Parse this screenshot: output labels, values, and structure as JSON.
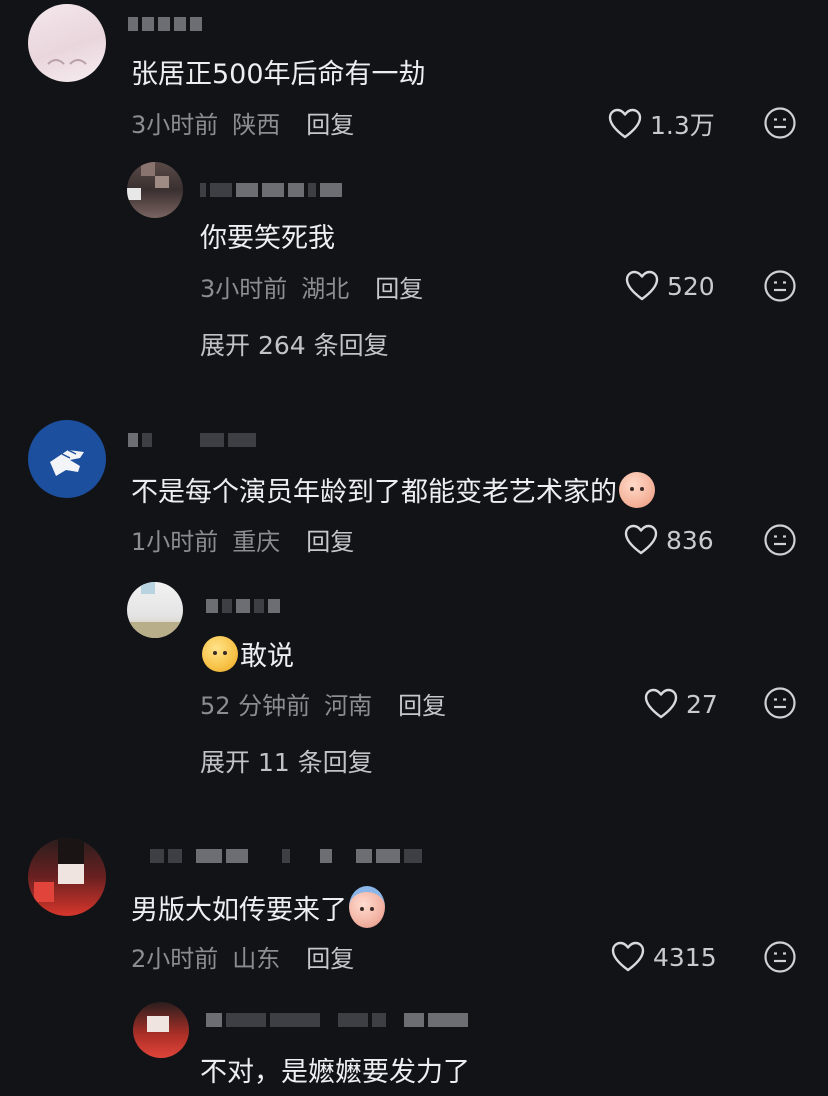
{
  "comments": [
    {
      "text": "张居正500年后命有一劫",
      "time": "3小时前",
      "location": "陕西",
      "reply_label": "回复",
      "likes": "1.3万",
      "replies": [
        {
          "text": "你要笑死我",
          "time": "3小时前",
          "location": "湖北",
          "reply_label": "回复",
          "likes": "520"
        }
      ],
      "expand_label": "展开 264 条回复"
    },
    {
      "text": "不是每个演员年龄到了都能变老艺术家的",
      "time": "1小时前",
      "location": "重庆",
      "reply_label": "回复",
      "likes": "836",
      "replies": [
        {
          "text": "敢说",
          "time": "52 分钟前",
          "location": "河南",
          "reply_label": "回复",
          "likes": "27"
        }
      ],
      "expand_label": "展开 11 条回复"
    },
    {
      "text": "男版大如传要来了",
      "time": "2小时前",
      "location": "山东",
      "reply_label": "回复",
      "likes": "4315",
      "replies": [
        {
          "text": "不对，是嬷嬷要发力了"
        }
      ]
    }
  ],
  "icons": {
    "like": "heart-outline-icon",
    "dislike": "meh-face-icon"
  },
  "colors": {
    "background": "#121316",
    "primary_text": "#eeeef0",
    "meta_text": "#8c8d92"
  }
}
